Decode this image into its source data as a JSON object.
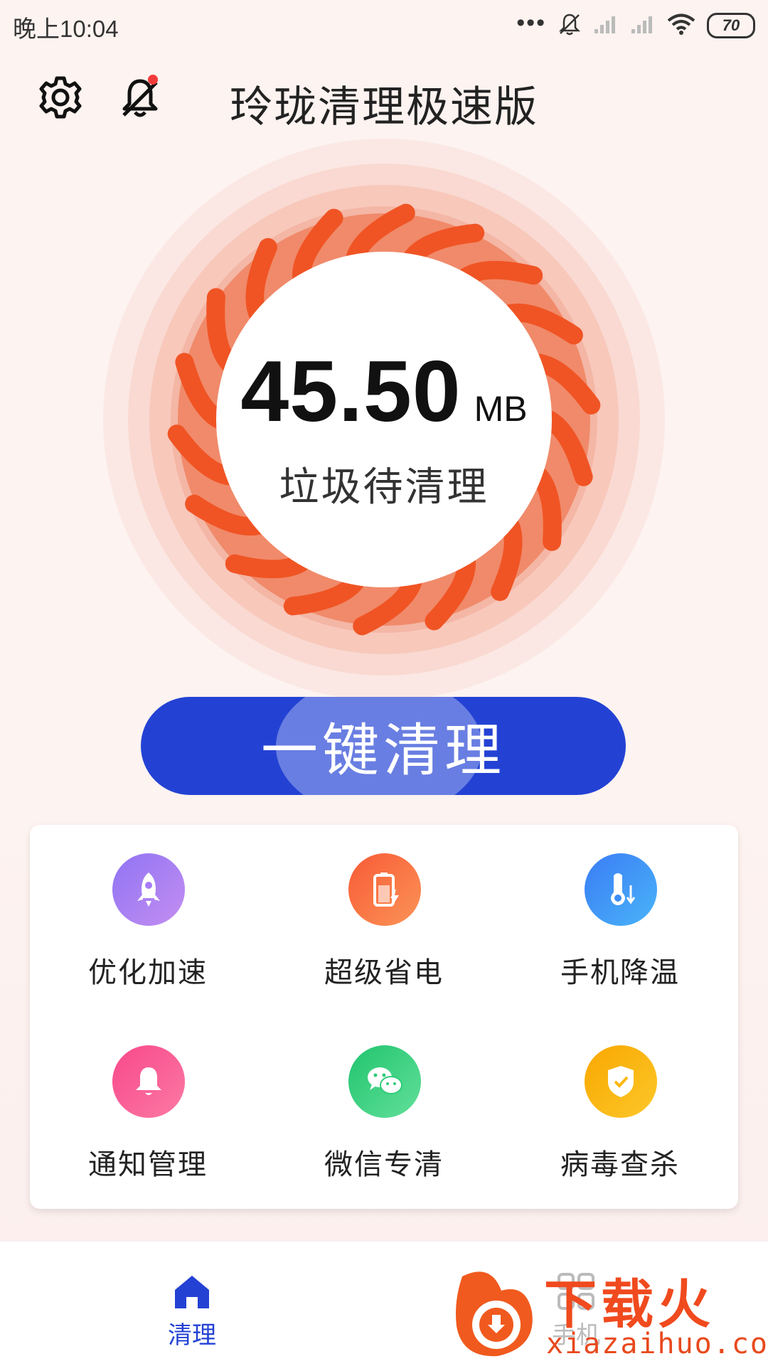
{
  "status_bar": {
    "time": "晚上10:04",
    "battery": "70",
    "more": "•••"
  },
  "header": {
    "title": "玲珑清理极速版"
  },
  "meter": {
    "size_value": "45.50",
    "size_unit": "MB",
    "caption": "垃圾待清理"
  },
  "clean_button": {
    "label": "一键清理"
  },
  "features": [
    {
      "label": "优化加速",
      "icon": "rocket-icon",
      "color": "#a77cf5"
    },
    {
      "label": "超级省电",
      "icon": "battery-icon",
      "color": "#f7673c"
    },
    {
      "label": "手机降温",
      "icon": "thermometer-icon",
      "color": "#3b8cf6"
    },
    {
      "label": "通知管理",
      "icon": "bell-icon",
      "color": "#f9588d"
    },
    {
      "label": "微信专清",
      "icon": "wechat-icon",
      "color": "#2fcb7a"
    },
    {
      "label": "病毒查杀",
      "icon": "shield-icon",
      "color": "#fbb80f"
    }
  ],
  "bottom_nav": [
    {
      "label": "清理",
      "icon": "home-icon",
      "active": true,
      "color": "#2342d4"
    },
    {
      "label": "手机",
      "icon": "grid-icon",
      "active": false,
      "color": "#bbbbbb"
    }
  ],
  "watermark": {
    "text": "下载火",
    "url": "xiazaihuo.com"
  },
  "colors": {
    "accent": "#2342d4",
    "meter_orange": "#f26a45",
    "meter_stripe": "#f05424",
    "notify_dot": "#f23a3a"
  }
}
